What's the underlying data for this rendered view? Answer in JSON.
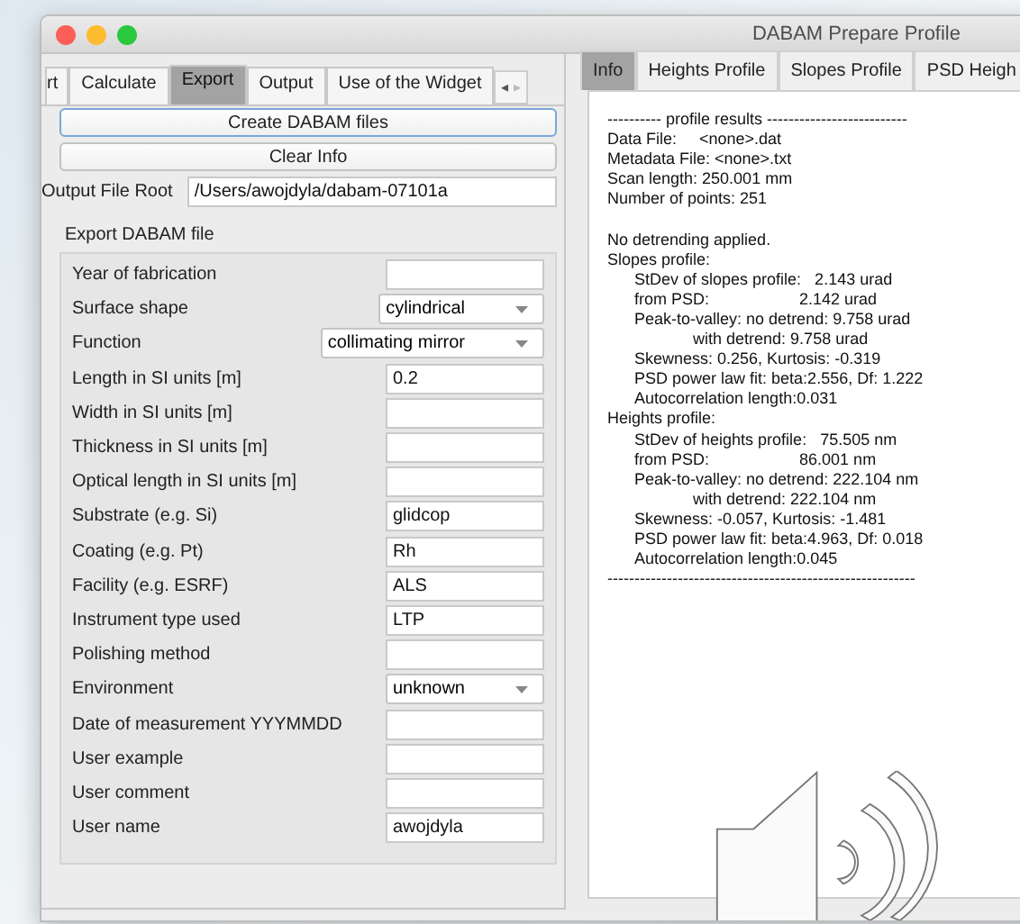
{
  "window": {
    "title": "DABAM Prepare Profile"
  },
  "left_tabs": [
    {
      "label": "rt",
      "selected": false
    },
    {
      "label": "Calculate",
      "selected": false
    },
    {
      "label": "Export",
      "selected": true
    },
    {
      "label": "Output",
      "selected": false
    },
    {
      "label": "Use of the Widget",
      "selected": false
    }
  ],
  "tab_scroll": {
    "left": "◂",
    "right": "▸"
  },
  "buttons": [
    "Create DABAM files",
    "Clear Info"
  ],
  "output_file_root": {
    "label": "Output File Root",
    "value": "/Users/awojdyla/dabam-07101a"
  },
  "export_group": {
    "title": "Export DABAM file",
    "rows": [
      {
        "label": "Year of fabrication",
        "kind": "text",
        "value": ""
      },
      {
        "label": "Surface shape",
        "kind": "dropdown",
        "value": "cylindrical"
      },
      {
        "label": "Function",
        "kind": "dropdown",
        "value": "collimating mirror"
      },
      {
        "label": "Length in SI units [m]",
        "kind": "text",
        "value": "0.2"
      },
      {
        "label": "Width in SI units [m]",
        "kind": "text",
        "value": ""
      },
      {
        "label": "Thickness in SI units [m]",
        "kind": "text",
        "value": ""
      },
      {
        "label": "Optical length in SI units [m]",
        "kind": "text",
        "value": ""
      },
      {
        "label": "Substrate (e.g. Si)",
        "kind": "text",
        "value": "glidcop"
      },
      {
        "label": "Coating (e.g. Pt)",
        "kind": "text",
        "value": "Rh"
      },
      {
        "label": "Facility (e.g. ESRF)",
        "kind": "text",
        "value": "ALS"
      },
      {
        "label": "Instrument type used",
        "kind": "text",
        "value": "LTP"
      },
      {
        "label": "Polishing method",
        "kind": "text",
        "value": ""
      },
      {
        "label": "Environment",
        "kind": "dropdown",
        "value": "unknown"
      },
      {
        "label": "Date of measurement YYYMMDD",
        "kind": "text",
        "value": ""
      },
      {
        "label": "User example",
        "kind": "text",
        "value": ""
      },
      {
        "label": "User comment",
        "kind": "text",
        "value": ""
      },
      {
        "label": "User name",
        "kind": "text",
        "value": "awojdyla"
      }
    ]
  },
  "right_tabs": [
    {
      "label": "Info",
      "selected": true
    },
    {
      "label": "Heights Profile",
      "selected": false
    },
    {
      "label": "Slopes Profile",
      "selected": false
    },
    {
      "label": "PSD Heigh",
      "selected": false
    }
  ],
  "info_text": "---------- profile results --------------------------\nData File:     <none>.dat\nMetadata File: <none>.txt\nScan length: 250.001 mm\nNumber of points: 251\n\nNo detrending applied.\nSlopes profile:\n\tStDev of slopes profile:   2.143 urad\n\tfrom PSD:                    2.142 urad\n\tPeak-to-valley: no detrend: 9.758 urad\n\t             with detrend: 9.758 urad\n\tSkewness: 0.256, Kurtosis: -0.319\n\tPSD power law fit: beta:2.556, Df: 1.222\n\tAutocorrelation length:0.031\nHeights profile:\n\tStDev of heights profile:   75.505 nm\n\tfrom PSD:                    86.001 nm\n\tPeak-to-valley: no detrend: 222.104 nm\n\t             with detrend: 222.104 nm\n\tSkewness: -0.057, Kurtosis: -1.481\n\tPSD power law fit: beta:4.963, Df: 0.018\n\tAutocorrelation length:0.045\n---------------------------------------------------------"
}
